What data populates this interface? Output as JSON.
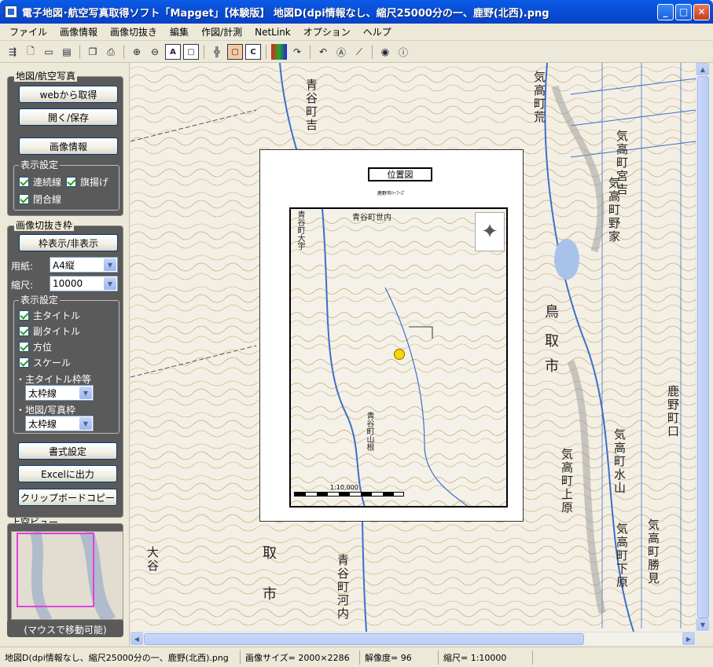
{
  "window": {
    "title": "電子地図･航空写真取得ソフト「Mapget」【体験版】 地図D(dpi情報なし、縮尺25000分の一、鹿野(北西).png",
    "minimize": "_",
    "maximize": "□",
    "close": "✕"
  },
  "menu": {
    "items": [
      "ファイル",
      "画像情報",
      "画像切抜き",
      "編集",
      "作図/計測",
      "NetLink",
      "オプション",
      "ヘルプ"
    ]
  },
  "toolbar": {
    "icons": [
      "open-file-icon",
      "new-file-icon",
      "folder-icon",
      "save-icon",
      "copy-icon",
      "print-icon",
      "zoom-in-icon",
      "zoom-out-icon",
      "fit-a-icon",
      "fit-box-icon",
      "grid-icon",
      "frame-icon",
      "crop-c-icon",
      "color-icon",
      "rotate-icon",
      "undo-icon",
      "text-a-icon",
      "line-icon",
      "globe-icon",
      "help-icon"
    ],
    "a_label": "A",
    "c_label": "C"
  },
  "left": {
    "group1_label": "地図/航空写真",
    "web_button": "webから取得",
    "open_save_button": "開く/保存",
    "image_info_button": "画像情報",
    "display_group_label": "表示設定",
    "checks1": [
      "連続線",
      "旗揚げ",
      "閉合線"
    ],
    "group2_label": "画像切抜き枠",
    "frame_toggle_button": "枠表示/非表示",
    "paper_label": "用紙:",
    "paper_value": "A4縦",
    "scale_label": "縮尺:",
    "scale_value": "10000",
    "display_group2_label": "表示設定",
    "checks2": [
      "主タイトル",
      "副タイトル",
      "方位",
      "スケール"
    ],
    "main_title_frame_label": "・主タイトル枠等",
    "main_title_frame_value": "太枠線",
    "map_frame_label": "・地図/写真枠",
    "map_frame_value": "太枠線",
    "format_button": "書式設定",
    "excel_button": "Excelに出力",
    "clipboard_button": "クリップボードコピー",
    "overview_label": "上空ビュー",
    "overview_caption": "(マウスで移動可能)"
  },
  "map": {
    "paper_title": "位置図",
    "paper_subtitle": "鹿野市ﾊｰﾌｰｽﾞ",
    "inner_labels": [
      "青谷町世内",
      "青谷町大宇",
      "青谷町山根"
    ],
    "scale_text": "1:10,000",
    "outer_labels": [
      "青谷町吉",
      "気高町宮吉",
      "気高町野家",
      "気高町水山",
      "気高町上原",
      "気高町下原",
      "青谷町河内",
      "鹿野町口",
      "気高町勝見",
      "気高町荒",
      "大谷"
    ],
    "kanji_labels": [
      "鳥",
      "取",
      "市",
      "取",
      "市"
    ]
  },
  "status": {
    "file": "地図D(dpi情報なし、縮尺25000分の一、鹿野(北西).png",
    "image_size": "画像サイズ= 2000×2286",
    "resolution": "解像度= 96",
    "scale": "縮尺= 1:10000"
  }
}
